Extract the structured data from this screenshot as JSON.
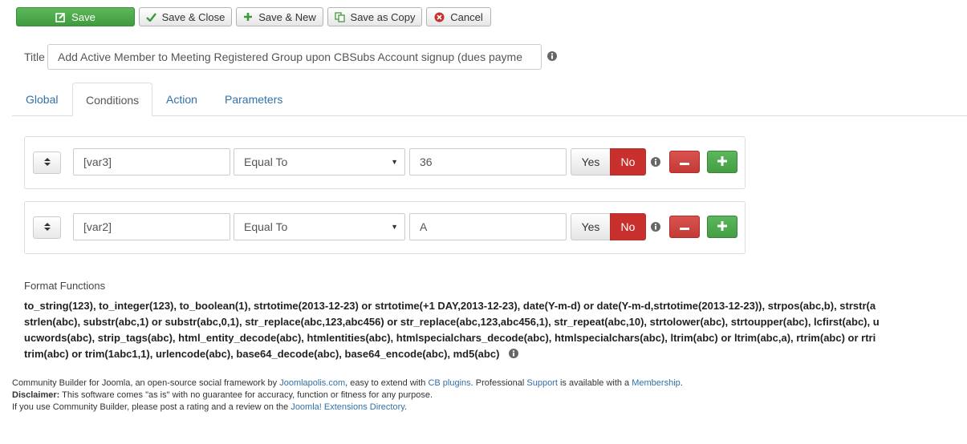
{
  "toolbar": {
    "save": "Save",
    "save_close": "Save & Close",
    "save_new": "Save & New",
    "save_copy": "Save as Copy",
    "cancel": "Cancel"
  },
  "title": {
    "label": "Title",
    "value": "Add Active Member to Meeting Registered Group upon CBSubs Account signup (dues payme"
  },
  "tabs": [
    {
      "label": "Global"
    },
    {
      "label": "Conditions"
    },
    {
      "label": "Action"
    },
    {
      "label": "Parameters"
    }
  ],
  "conditions": [
    {
      "field": "[var3]",
      "operator": "Equal To",
      "value": "36",
      "yes": "Yes",
      "no": "No"
    },
    {
      "field": "[var2]",
      "operator": "Equal To",
      "value": "A",
      "yes": "Yes",
      "no": "No"
    }
  ],
  "format_functions": {
    "label": "Format Functions",
    "lines": [
      "to_string(123), to_integer(123), to_boolean(1), strtotime(2013-12-23) or strtotime(+1 DAY,2013-12-23), date(Y-m-d) or date(Y-m-d,strtotime(2013-12-23)), strpos(abc,b), strstr(a",
      "strlen(abc), substr(abc,1) or substr(abc,0,1), str_replace(abc,123,abc456) or str_replace(abc,123,abc456,1), str_repeat(abc,10), strtolower(abc), strtoupper(abc), lcfirst(abc), u",
      "ucwords(abc), strip_tags(abc), html_entity_decode(abc), htmlentities(abc), htmlspecialchars_decode(abc), htmlspecialchars(abc), ltrim(abc) or ltrim(abc,a), rtrim(abc) or rtri",
      "trim(abc) or trim(1abc1,1), urlencode(abc), base64_decode(abc), base64_encode(abc), md5(abc)"
    ]
  },
  "footer": {
    "l1_a": "Community Builder for Joomla, an open-source social framework by ",
    "l1_link1": "Joomlapolis.com",
    "l1_b": ", easy to extend with ",
    "l1_link2": "CB plugins",
    "l1_c": ". Professional ",
    "l1_link3": "Support",
    "l1_d": " is available with a ",
    "l1_link4": "Membership",
    "l1_e": ".",
    "l2_bold": "Disclaimer:",
    "l2_text": " This software comes \"as is\" with no guarantee for accuracy, function or fitness for any purpose.",
    "l3_a": "If you use Community Builder, please post a rating and a review on the ",
    "l3_link": "Joomla! Extensions Directory",
    "l3_b": "."
  },
  "colors": {
    "save_green": "#4cae4c",
    "danger_red": "#c7302c",
    "link_blue": "#3071a9"
  },
  "icons": {
    "save": "edit-icon",
    "save_close": "check-icon",
    "save_new": "plus-icon",
    "save_copy": "copy-icon",
    "cancel": "cancel-circle-icon",
    "info": "info-icon",
    "sort": "sort-icon",
    "remove": "minus-icon",
    "add": "plus-icon"
  }
}
